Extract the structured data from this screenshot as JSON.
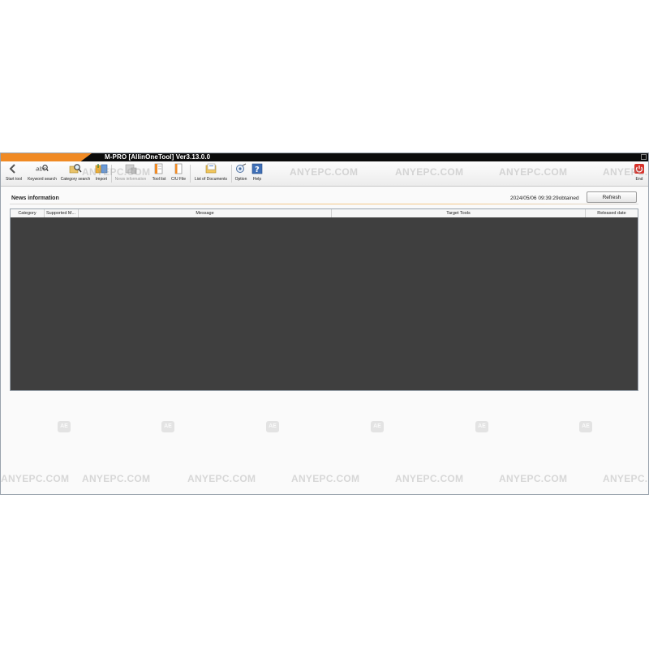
{
  "window": {
    "title": "M-PRO [AllinOneTool] Ver3.13.0.0",
    "accent_color": "#f08a24",
    "titlebar_color": "#0b0b0b"
  },
  "toolbar": {
    "items": [
      {
        "label": "Start tool",
        "icon": "back-arrow-icon",
        "enabled": true
      },
      {
        "label": "Keyword search",
        "icon": "abc-search-icon",
        "enabled": true
      },
      {
        "label": "Category search",
        "icon": "folder-search-icon",
        "enabled": true
      },
      {
        "label": "Import",
        "icon": "import-icon",
        "enabled": true
      },
      {
        "label": "News information",
        "icon": "news-icon",
        "enabled": false
      },
      {
        "label": "Tool list",
        "icon": "tool-list-icon",
        "enabled": true
      },
      {
        "label": "C/U File",
        "icon": "file-icon",
        "enabled": true
      },
      {
        "label": "List of Documents",
        "icon": "documents-icon",
        "enabled": true
      },
      {
        "label": "Option",
        "icon": "option-icon",
        "enabled": true
      },
      {
        "label": "Help",
        "icon": "help-icon",
        "enabled": true
      },
      {
        "label": "End",
        "icon": "power-icon",
        "enabled": true
      }
    ]
  },
  "news": {
    "title": "News information",
    "obtained": "2024/05/06 09:39:29obtained",
    "refresh_label": "Refresh",
    "columns": [
      "Category",
      "Supported  M...",
      "Message",
      "Target Tools",
      "Released date"
    ],
    "rows": []
  },
  "watermark": {
    "text": "ANYEPC.COM",
    "badge": "AE"
  }
}
